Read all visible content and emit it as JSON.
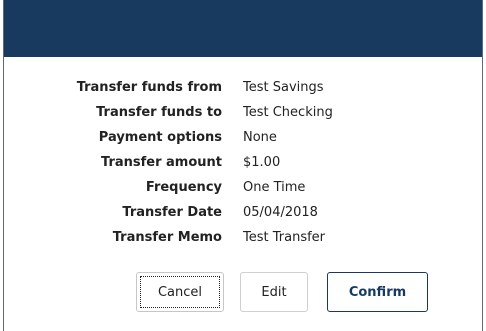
{
  "colors": {
    "header_bg": "#173a5e",
    "confirm_border": "#173a5e",
    "text": "#222222"
  },
  "details": [
    {
      "label": "Transfer funds from",
      "value": "Test Savings"
    },
    {
      "label": "Transfer funds to",
      "value": "Test Checking"
    },
    {
      "label": "Payment options",
      "value": "None"
    },
    {
      "label": "Transfer amount",
      "value": "$1.00"
    },
    {
      "label": "Frequency",
      "value": "One Time"
    },
    {
      "label": "Transfer Date",
      "value": "05/04/2018"
    },
    {
      "label": "Transfer Memo",
      "value": "Test Transfer"
    }
  ],
  "actions": {
    "cancel_label": "Cancel",
    "edit_label": "Edit",
    "confirm_label": "Confirm"
  }
}
